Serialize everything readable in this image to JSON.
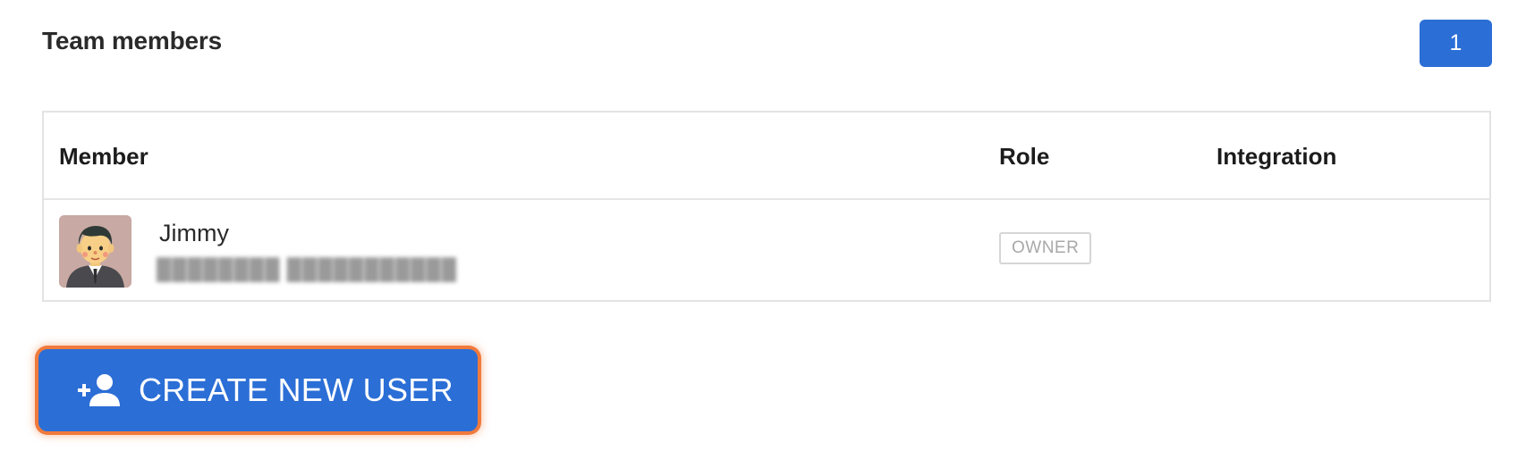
{
  "header": {
    "title": "Team members",
    "member_count": "1"
  },
  "table": {
    "columns": {
      "member": "Member",
      "role": "Role",
      "integration": "Integration"
    },
    "rows": [
      {
        "name": "Jimmy",
        "email": "████████ ████████████",
        "role": "OWNER",
        "integration": "",
        "avatar_icon": "person-avatar-icon"
      }
    ]
  },
  "actions": {
    "create_user_label": "CREATE NEW USER",
    "create_user_icon": "add-person-icon"
  },
  "colors": {
    "primary": "#2b6ed6",
    "highlight_outline": "#f07a3c",
    "border": "#e3e3e3"
  }
}
